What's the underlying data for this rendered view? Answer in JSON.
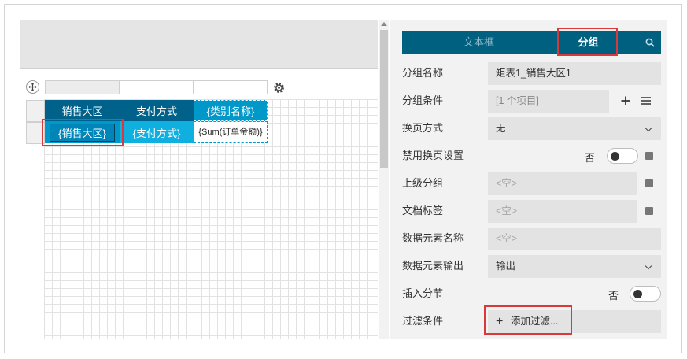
{
  "designer": {
    "header_row": [
      "销售大区",
      "支付方式",
      "{类别名称}"
    ],
    "detail_row": [
      "{销售大区}",
      "{支付方式}",
      "{Sum(订单金额)}"
    ]
  },
  "panel": {
    "tabs": {
      "text_box": "文本框",
      "group": "分组"
    },
    "props": {
      "group_name": {
        "label": "分组名称",
        "value": "矩表1_销售大区1"
      },
      "group_condition": {
        "label": "分组条件",
        "value": "[1 个项目]"
      },
      "page_break": {
        "label": "换页方式",
        "value": "无"
      },
      "disable_page_break": {
        "label": "禁用换页设置",
        "value": "否"
      },
      "parent_group": {
        "label": "上级分组",
        "placeholder": "<空>"
      },
      "doc_label": {
        "label": "文档标签",
        "placeholder": "<空>"
      },
      "data_element_name": {
        "label": "数据元素名称",
        "placeholder": "<空>"
      },
      "data_element_output": {
        "label": "数据元素输出",
        "value": "输出"
      },
      "insert_section": {
        "label": "插入分节",
        "value": "否"
      },
      "filter": {
        "label": "过滤条件",
        "button": "添加过滤..."
      }
    }
  },
  "colors": {
    "header": "#00618a",
    "detail": "#0097c9",
    "highlight": "#d9393b",
    "tabbar": "#00607f"
  }
}
